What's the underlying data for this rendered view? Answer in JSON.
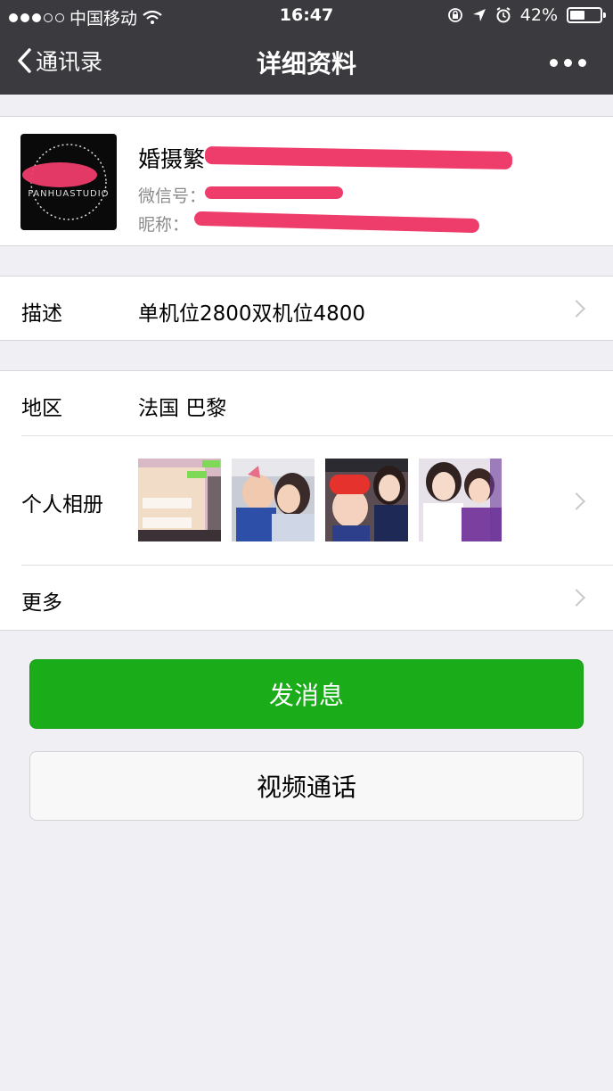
{
  "status": {
    "carrier": "中国移动",
    "time": "16:47",
    "battery": "42%",
    "battery_level": 0.42
  },
  "nav": {
    "back_label": "通讯录",
    "title": "详细资料"
  },
  "profile": {
    "name_visible": "婚摄繁",
    "wechat_label": "微信号：",
    "nickname_label": "昵称：",
    "avatar_text": "FANHUASTUDIO"
  },
  "description": {
    "label": "描述",
    "value": "单机位2800双机位4800"
  },
  "region": {
    "label": "地区",
    "value": "法国 巴黎"
  },
  "album": {
    "label": "个人相册"
  },
  "more": {
    "label": "更多"
  },
  "actions": {
    "message": "发消息",
    "video_call": "视频通话"
  },
  "colors": {
    "nav_bg": "#3a3a3f",
    "page_bg": "#efeff4",
    "primary_green": "#1aad19",
    "redaction": "#ee3c6b"
  }
}
